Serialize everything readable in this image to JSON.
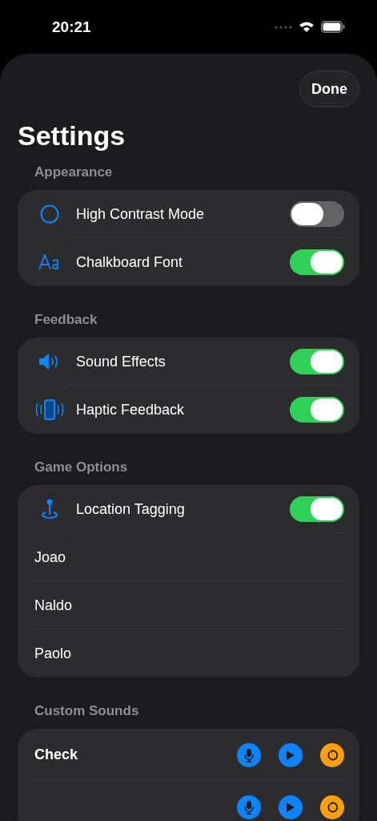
{
  "status_bar": {
    "time": "20:21"
  },
  "done_button": "Done",
  "title": "Settings",
  "sections": [
    {
      "header": "Appearance",
      "rows": [
        {
          "kind": "contrast",
          "label": "High Contrast Mode",
          "on": false
        },
        {
          "kind": "font",
          "label": "Chalkboard Font",
          "on": true
        }
      ]
    },
    {
      "header": "Feedback",
      "rows": [
        {
          "kind": "audio",
          "label": "Sound Effects",
          "on": true
        },
        {
          "kind": "haptic",
          "label": "Haptic Feedback",
          "on": true
        }
      ]
    },
    {
      "header": "Game Options",
      "rows": [
        {
          "kind": "location",
          "label": "Location Tagging",
          "on": true
        },
        {
          "kind": "plain",
          "label": "Joao"
        },
        {
          "kind": "plain",
          "label": "Naldo"
        },
        {
          "kind": "plain",
          "label": "Paolo"
        }
      ]
    },
    {
      "header": "Custom Sounds",
      "rows": [
        {
          "kind": "sound",
          "label": "Check"
        },
        {
          "kind": "sound"
        }
      ]
    }
  ]
}
